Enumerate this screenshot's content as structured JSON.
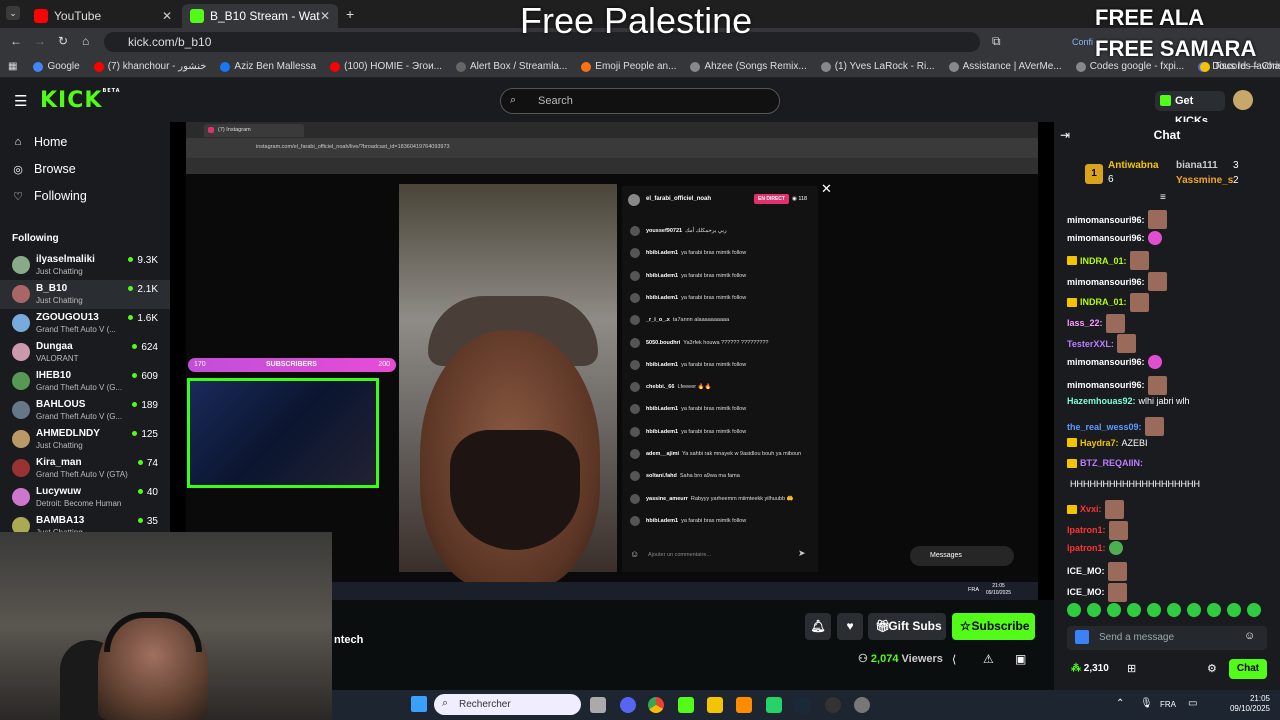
{
  "browser": {
    "tabs": [
      {
        "label": "YouTube",
        "color": "#ff0000"
      },
      {
        "label": "B_B10 Stream - Watch Live on K",
        "color": "#53fc18"
      }
    ],
    "url": "kick.com/b_b10",
    "bookmarks": [
      "Google",
      "(7) khanchour - خنشور",
      "Aziz Ben Mallessa",
      "(100) HOMIE - Эгои...",
      "Alert Box / Streamla...",
      "Emoji People an...",
      "Ahzee (Songs Remix...",
      "(1) Yves LaRock - Ri...",
      "Assistance | AVerMe...",
      "Codes google - fxpi...",
      "Discord — Chat voc...",
      "Tous les favoris"
    ],
    "confi": "Confi"
  },
  "overlay": {
    "center": "Free Palestine",
    "right1": "FREE ALA",
    "right2": "FREE SAMARA"
  },
  "header": {
    "logo": "KICK",
    "logo_beta": "BETA",
    "search_placeholder": "Search",
    "get_kicks": "Get KICKs"
  },
  "sidebar": {
    "nav": [
      {
        "label": "Home",
        "icon": "home-icon"
      },
      {
        "label": "Browse",
        "icon": "compass-icon"
      },
      {
        "label": "Following",
        "icon": "heart-icon"
      }
    ],
    "following_title": "Following",
    "following": [
      {
        "name": "ilyaselmaliki",
        "game": "Just Chatting",
        "viewers": "9.3K"
      },
      {
        "name": "B_B10",
        "game": "Just Chatting",
        "viewers": "2.1K"
      },
      {
        "name": "ZGOUGOU13",
        "game": "Grand Theft Auto V (...",
        "viewers": "1.6K"
      },
      {
        "name": "Dungaa",
        "game": "VALORANT",
        "viewers": "624"
      },
      {
        "name": "IHEB10",
        "game": "Grand Theft Auto V (G...",
        "viewers": "609"
      },
      {
        "name": "BAHLOUS",
        "game": "Grand Theft Auto V (G...",
        "viewers": "189"
      },
      {
        "name": "AHMEDLNDY",
        "game": "Just Chatting",
        "viewers": "125"
      },
      {
        "name": "Kira_man",
        "game": "Grand Theft Auto V (GTA)",
        "viewers": "74"
      },
      {
        "name": "Lucywuw",
        "game": "Detroit: Become Human",
        "viewers": "40"
      },
      {
        "name": "BAMBA13",
        "game": "Just Chatting",
        "viewers": "35"
      }
    ]
  },
  "stream": {
    "inner_tab": "(7) Instagram",
    "inner_url": "instagram.com/el_farabi_officiel_noah/live/?broadcast_id=18360419764093973",
    "ig_user": "el_farabi_officiel_noah",
    "ig_live": "EN DIRECT",
    "ig_viewers": "118",
    "ig_comments": [
      {
        "user": "youssef90721",
        "text": "ربي يرحمكلك أمك"
      },
      {
        "user": "hbibi.adem1",
        "text": "ya farabi bras mimtk follow"
      },
      {
        "user": "hbibi.adem1",
        "text": "ya farabi bras mimtk follow"
      },
      {
        "user": "hbibi.adem1",
        "text": "ya farabi bras mimtk follow"
      },
      {
        "user": "_r_i_o_.x",
        "text": "ta7annn alaaaaaaaaaa"
      },
      {
        "user": "5050.boudhri",
        "text": "Ya3rfek houwa ?????? ?????????"
      },
      {
        "user": "hbibi.adem1",
        "text": "ya farabi bras mimtk follow"
      },
      {
        "user": "chebbi._66",
        "text": "Lfeeeer 🔥🔥"
      },
      {
        "user": "hbibi.adem1",
        "text": "ya farabi bras mimtk follow"
      },
      {
        "user": "hbibi.adem1",
        "text": "ya farabi bras mimtk follow"
      },
      {
        "user": "adem__ajimi",
        "text": "Ya sahbi rak mnayek w 9asidlou bouh ya miboun"
      },
      {
        "user": "soltani.fahd",
        "text": "Saha bro a9wa ma fama"
      },
      {
        "user": "yassine_ameurr",
        "text": "Rabyyy yarheemm miimteekk yilhuubb 🤲"
      },
      {
        "user": "hbibi.adem1",
        "text": "ya farabi bras mimtk follow"
      }
    ],
    "ig_input": "Ajouter un commentaire...",
    "ig_messages": "Messages",
    "sub_count_left": "170",
    "sub_label": "SUBSCRIBERS",
    "sub_count_right": "200",
    "inner_clock_time": "21:05",
    "inner_clock_date": "09/10/2025",
    "inner_lang": "FRA"
  },
  "below": {
    "channel_partial": "ntech",
    "gift_subs": "Gift Subs",
    "subscribe": "Subscribe",
    "viewers_count": "2,074",
    "viewers_label": "Viewers"
  },
  "chat": {
    "title": "Chat",
    "top_gifters": [
      {
        "name": "Antiwabna",
        "count": "6",
        "rank": "1"
      },
      {
        "name": "biana111",
        "count": "3"
      },
      {
        "name": "Yassmine_s",
        "count": "2"
      }
    ],
    "messages": [
      {
        "user": "mimomansouri96:",
        "color": "#ffffff",
        "text": "",
        "emote": "face"
      },
      {
        "user": "mimomansouri96:",
        "color": "#ffffff",
        "text": "",
        "emote": "pink"
      },
      {
        "user": "INDRA_01:",
        "color": "#b6ff00",
        "text": "",
        "emote": "face",
        "badge": true
      },
      {
        "user": "mimomansouri96:",
        "color": "#ffffff",
        "text": "",
        "emote": "face"
      },
      {
        "user": "INDRA_01:",
        "color": "#b6ff00",
        "text": "",
        "emote": "face",
        "badge": true
      },
      {
        "user": "lass_22:",
        "color": "#ff99ff",
        "text": "",
        "emote": "face"
      },
      {
        "user": "TesterXXL:",
        "color": "#bd7dff",
        "text": "",
        "emote": "face"
      },
      {
        "user": "mimomansouri96:",
        "color": "#ffffff",
        "text": "",
        "emote": "pink"
      },
      {
        "user": "mimomansouri96:",
        "color": "#ffffff",
        "text": "",
        "emote": "face"
      },
      {
        "user": "Hazemhouas92:",
        "color": "#7fffd4",
        "text": "wlhi jabri wlh",
        "emote": ""
      },
      {
        "user": "the_real_wess09:",
        "color": "#5f9bff",
        "text": "",
        "emote": "face"
      },
      {
        "user": "Haydra7:",
        "color": "#f5c400",
        "text": "AZEBI",
        "emote": "",
        "badge": true
      },
      {
        "user": "BTZ_REQAIIN:",
        "color": "#bd7dff",
        "text": "",
        "emote": "",
        "badge": true
      },
      {
        "user": "",
        "color": "#ffffff",
        "text": "HHHHHHHHHHHHHHHHHHHH",
        "emote": ""
      },
      {
        "user": "Xvxi:",
        "color": "#ff3333",
        "text": "",
        "emote": "face",
        "badge": true
      },
      {
        "user": "lpatron1:",
        "color": "#ff3333",
        "text": "",
        "emote": "face"
      },
      {
        "user": "lpatron1:",
        "color": "#ff3333",
        "text": "",
        "emote": "green"
      },
      {
        "user": "ICE_MO:",
        "color": "#ffffff",
        "text": "",
        "emote": "face"
      },
      {
        "user": "ICE_MO:",
        "color": "#ffffff",
        "text": "",
        "emote": "face"
      }
    ],
    "input_placeholder": "Send a message",
    "points": "2,310",
    "send": "Chat"
  },
  "taskbar": {
    "search": "Rechercher",
    "lang": "FRA",
    "time": "21:05",
    "date": "09/10/2025"
  }
}
